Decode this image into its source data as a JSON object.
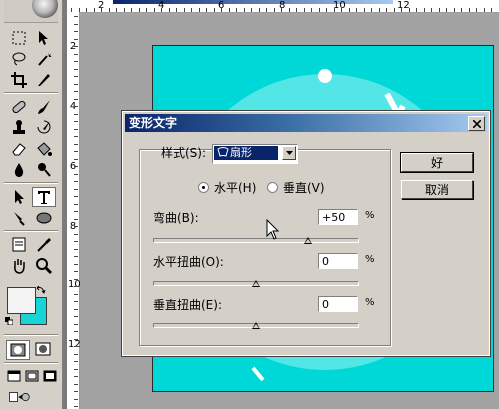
{
  "dialog": {
    "title": "变形文字",
    "style_label": "样式(S):",
    "style_value": "扇形",
    "orientation": {
      "horizontal_label": "水平(H)",
      "vertical_label": "垂直(V)",
      "selected": "horizontal"
    },
    "bend": {
      "label": "弯曲(B):",
      "value": "+50",
      "unit": "%",
      "fraction": 0.75
    },
    "h_distort": {
      "label": "水平扭曲(O):",
      "value": "0",
      "unit": "%",
      "fraction": 0.5
    },
    "v_distort": {
      "label": "垂直扭曲(E):",
      "value": "0",
      "unit": "%",
      "fraction": 0.5
    },
    "ok_label": "好",
    "cancel_label": "取消"
  },
  "ruler": {
    "top_ticks": [
      "2",
      "4",
      "6",
      "8",
      "10",
      "12"
    ],
    "left_ticks": [
      "2",
      "4",
      "6",
      "8",
      "10",
      "12"
    ]
  },
  "toolbox": {
    "foreground_color": "#f4f4f4",
    "background_color": "#19d4d4"
  },
  "canvas": {
    "background_color": "#00d8d8",
    "ring_color": "#5aeaea",
    "text_color": "#ffffff"
  }
}
